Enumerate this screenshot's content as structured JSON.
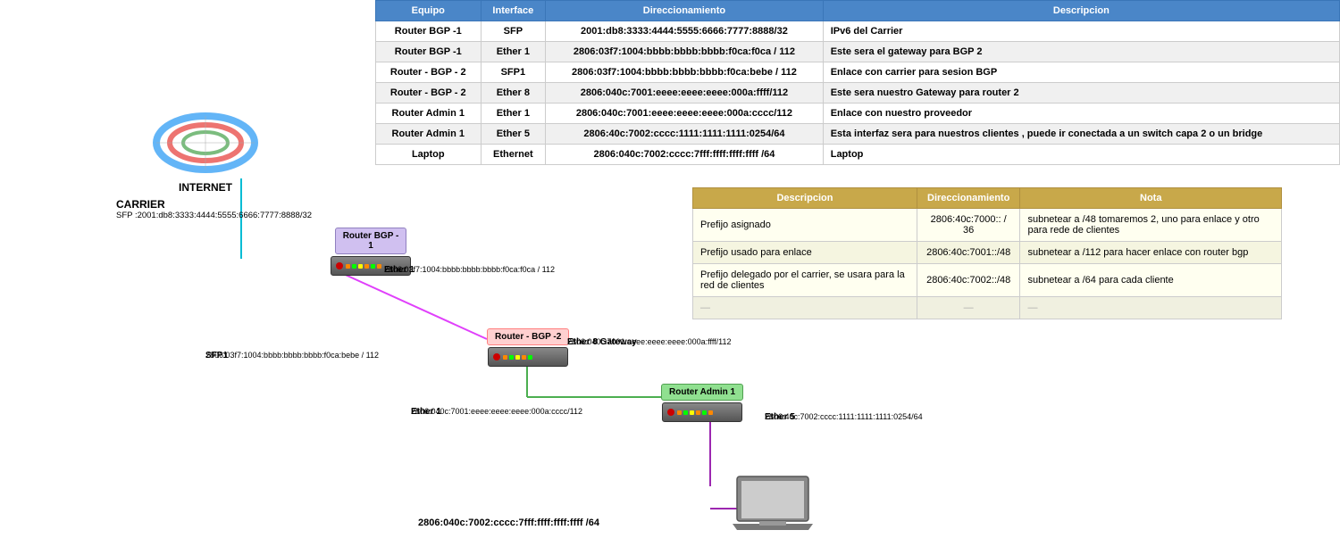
{
  "table1": {
    "headers": [
      "Equipo",
      "Interface",
      "Direccionamiento",
      "Descripcion"
    ],
    "rows": [
      [
        "Router BGP -1",
        "SFP",
        "2001:db8:3333:4444:5555:6666:7777:8888/32",
        "IPv6 del Carrier"
      ],
      [
        "Router BGP -1",
        "Ether 1",
        "2806:03f7:1004:bbbb:bbbb:bbbb:f0ca:f0ca / 112",
        "Este sera el gateway para BGP 2"
      ],
      [
        "Router - BGP - 2",
        "SFP1",
        "2806:03f7:1004:bbbb:bbbb:bbbb:f0ca:bebe / 112",
        "Enlace con carrier para sesion BGP"
      ],
      [
        "Router - BGP - 2",
        "Ether 8",
        "2806:040c:7001:eeee:eeee:eeee:000a:ffff/112",
        "Este sera nuestro Gateway para router 2"
      ],
      [
        "Router Admin 1",
        "Ether 1",
        "2806:040c:7001:eeee:eeee:eeee:000a:cccc/112",
        "Enlace con nuestro proveedor"
      ],
      [
        "Router Admin 1",
        "Ether 5",
        "2806:40c:7002:cccc:1111:1111:1111:0254/64",
        "Esta interfaz sera para nuestros clientes , puede ir conectada a un switch capa 2 o un bridge"
      ],
      [
        "Laptop",
        "Ethernet",
        "2806:040c:7002:cccc:7fff:ffff:ffff:ffff /64",
        "Laptop"
      ]
    ]
  },
  "table2": {
    "headers": [
      "Descripcion",
      "Direccionamiento",
      "Nota"
    ],
    "rows": [
      [
        "Prefijo asignado",
        "2806:40c:7000:: / 36",
        "subnetear a /48  tomaremos 2, uno para enlace y otro para rede de clientes"
      ],
      [
        "Prefijo usado para enlace",
        "2806:40c:7001::/48",
        "subnetear a /112 para hacer enlace con router bgp"
      ],
      [
        "Prefijo delegado por el carrier, se usara para la red de clientes",
        "2806:40c:7002::/48",
        "subnetear a /64 para cada cliente"
      ],
      [
        "—",
        "—",
        "—"
      ]
    ]
  },
  "diagram": {
    "internet_label": "INTERNET",
    "carrier_label": "CARRIER",
    "carrier_address": "SFP :2001:db8:3333:4444:5555:6666:7777:8888/32",
    "router_bgp1_label": "Router BGP -\n1",
    "router_bgp2_label": "Router - BGP -2",
    "router_admin1_label": "Router Admin 1",
    "ether1_label": "Ether 1",
    "ether1_address": "2806:03f7:1004:bbbb:bbbb:bbbb:f0ca:f0ca / 112",
    "sfp1_label": "SFP1",
    "sfp1_address": "2806:03f7:1004:bbbb:bbbb:bbbb:f0ca:bebe / 112",
    "ether8_label": "Ether 8 Gateway",
    "ether8_address": "2806:040c:7001:eeee:eeee:eeee:000a:ffff/112",
    "ether1_admin_label": "Ether 1",
    "ether1_admin_address": "2806:040c:7001:eeee:eeee:eeee:000a:cccc/112",
    "ether5_label": "Ether 5",
    "ether5_address": "2806:40c:7002:cccc:1111:1111:1111:0254/64",
    "laptop_address": "2806:040c:7002:cccc:7fff:ffff:ffff:ffff /64",
    "laptop_label": "Laptop"
  }
}
